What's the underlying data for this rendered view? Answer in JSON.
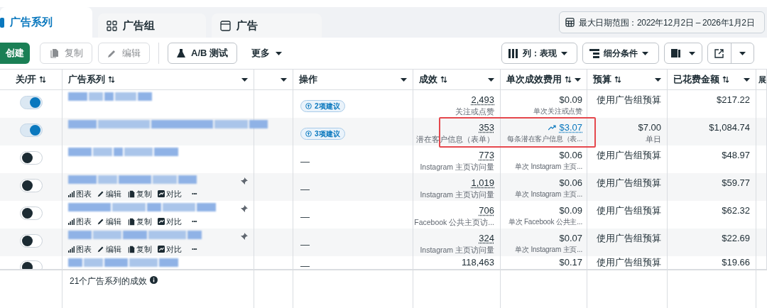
{
  "tabs": [
    {
      "label": "广告系列",
      "selected": true
    },
    {
      "label": "广告组",
      "selected": false
    },
    {
      "label": "广告",
      "selected": false
    }
  ],
  "date_range": "最大日期范围：2022年12月2日 – 2026年1月2日",
  "toolbar": [
    {
      "label": "创建",
      "kind": "primary",
      "disabled": false
    },
    {
      "label": "复制",
      "kind": "copy",
      "disabled": true
    },
    {
      "label": "编辑",
      "kind": "edit",
      "disabled": true
    },
    {
      "label": "A/B 测试",
      "kind": "flask",
      "disabled": false
    },
    {
      "label": "更多",
      "kind": "menu",
      "disabled": false
    }
  ],
  "toolbar_right": [
    {
      "label": "列：表现",
      "kind": "columns"
    },
    {
      "label": "细分条件",
      "kind": "breakdown"
    }
  ],
  "table": {
    "columns": [
      {
        "label": "关/开",
        "sortable": true,
        "menu": false
      },
      {
        "label": "广告系列",
        "sortable": true,
        "menu": true
      },
      {
        "sortable": false,
        "menu": true
      },
      {
        "label": "操作",
        "sortable": false,
        "menu": true
      },
      {
        "label": "成效",
        "sortable": true,
        "menu": true
      },
      {
        "label": "单次成效费用",
        "sortable": true,
        "menu": true
      },
      {
        "label": "预算",
        "sortable": true,
        "menu": true
      },
      {
        "label": "已花费金额",
        "sortable": true,
        "menu": true
      },
      {
        "label": "展"
      }
    ],
    "rows": [
      {
        "on": true,
        "pinned": false,
        "action": "2项建议",
        "kind": "suggestion",
        "results": "2,493",
        "results_sub": "关注或点赞",
        "cost": "$0.09",
        "cost_sub": "单次关注或点赞",
        "cost_trend": false,
        "budget": "使用广告组预算",
        "spent": "$217.22",
        "highlighted": false
      },
      {
        "on": true,
        "pinned": false,
        "action": "3项建议",
        "kind": "suggestion",
        "results": "353",
        "results_sub": "潜在客户信息（表单）",
        "cost": "$3.07",
        "cost_sub": "每条潜在客户信息（表...",
        "cost_trend": true,
        "budget": "$7.00",
        "budget_sub": "单日",
        "spent": "$1,084.74",
        "highlighted": true
      },
      {
        "on": false,
        "pinned": false,
        "action": "—",
        "kind": "empty",
        "results": "773",
        "results_sub": "Instagram 主页访问量",
        "cost": "$0.06",
        "cost_sub": "单次 Instagram 主页...",
        "cost_trend": false,
        "budget": "使用广告组预算",
        "spent": "$48.97",
        "highlighted": false
      },
      {
        "on": false,
        "pinned": true,
        "actions": [
          "图表",
          "编辑",
          "复制",
          "对比",
          "•••"
        ],
        "action": "—",
        "kind": "empty",
        "results": "1,019",
        "results_sub": "Instagram 主页访问量",
        "cost": "$0.06",
        "cost_sub": "单次 Instagram 主页...",
        "cost_trend": false,
        "budget": "使用广告组预算",
        "spent": "$59.77",
        "highlighted": false
      },
      {
        "on": false,
        "pinned": true,
        "actions": [
          "图表",
          "编辑",
          "复制",
          "对比",
          "•••"
        ],
        "action": "—",
        "kind": "empty",
        "results": "706",
        "results_sub": "Facebook 公共主页访...",
        "cost": "$0.09",
        "cost_sub": "单次 Facebook 公共主...",
        "cost_trend": false,
        "budget": "使用广告组预算",
        "spent": "$62.32",
        "highlighted": false
      },
      {
        "on": false,
        "pinned": true,
        "actions": [
          "图表",
          "编辑",
          "复制",
          "对比",
          "•••"
        ],
        "action": "—",
        "kind": "empty",
        "results": "324",
        "results_sub": "Instagram 主页访问量",
        "cost": "$0.07",
        "cost_sub": "单次 Instagram 主页...",
        "cost_trend": false,
        "budget": "使用广告组预算",
        "spent": "$22.69",
        "highlighted": false
      },
      {
        "on": false,
        "pinned": false,
        "action": "—",
        "kind": "empty",
        "results": "118,463",
        "cost": "$0.17",
        "cost_trend": false,
        "budget": "使用广告组预算",
        "spent": "$19.66",
        "highlighted": false
      }
    ],
    "footer": "21个广告系列的成效"
  }
}
